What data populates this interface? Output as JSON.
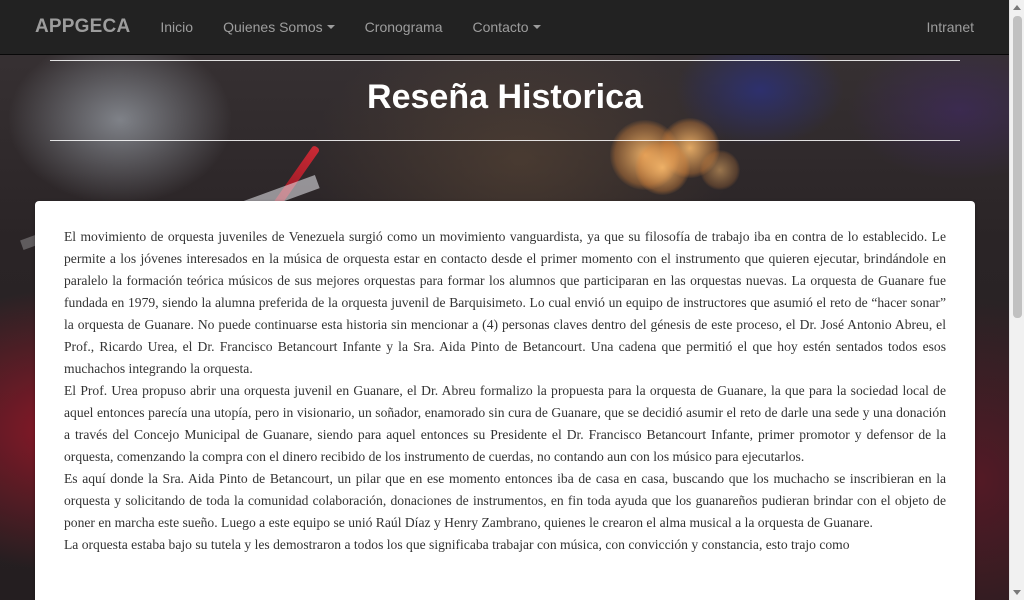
{
  "navbar": {
    "brand": "APPGECA",
    "items": [
      {
        "label": "Inicio",
        "dropdown": false
      },
      {
        "label": "Quienes Somos",
        "dropdown": true
      },
      {
        "label": "Cronograma",
        "dropdown": false
      },
      {
        "label": "Contacto",
        "dropdown": true
      }
    ],
    "right_item": "Intranet"
  },
  "header": {
    "title": "Reseña Historica"
  },
  "content": {
    "paragraphs": [
      "El movimiento de orquesta juveniles de Venezuela surgió como un movimiento vanguardista, ya que su filosofía de trabajo iba en contra de lo establecido. Le permite a los jóvenes interesados en la música de orquesta estar en contacto desde el primer momento con el instrumento que quieren ejecutar, brindándole en paralelo la formación teórica músicos de sus mejores orquestas para formar los alumnos que participaran en las orquestas nuevas. La orquesta de Guanare fue fundada en 1979, siendo la alumna preferida de la orquesta juvenil de Barquisimeto. Lo cual envió un equipo de instructores que asumió el reto de “hacer sonar” la orquesta de Guanare. No puede continuarse esta historia sin mencionar a (4) personas claves dentro del génesis de este proceso, el Dr. José Antonio Abreu, el Prof., Ricardo Urea, el Dr. Francisco Betancourt Infante y la Sra. Aida Pinto de Betancourt. Una cadena que permitió el que hoy estén sentados todos esos muchachos integrando la orquesta.",
      "El Prof. Urea propuso abrir una orquesta juvenil en Guanare, el Dr. Abreu formalizo la propuesta para la orquesta de Guanare, la que para la sociedad local de aquel entonces parecía una utopía, pero in visionario, un soñador, enamorado sin cura de Guanare, que se decidió asumir el reto de darle una sede y una donación a través del Concejo Municipal de Guanare, siendo para aquel entonces su Presidente el Dr. Francisco Betancourt Infante, primer promotor y defensor de la orquesta, comenzando la compra con el dinero recibido de los instrumento de cuerdas, no contando aun con los músico para ejecutarlos.",
      "Es aquí donde la Sra. Aida Pinto de Betancourt, un pilar que en ese momento entonces iba de casa en casa, buscando que los muchacho se inscribieran en la orquesta y solicitando de toda la comunidad colaboración, donaciones de instrumentos, en fin toda ayuda que los guanareños pudieran brindar con el objeto de poner en marcha este sueño. Luego a este equipo se unió Raúl Díaz y Henry Zambrano, quienes le crearon el alma musical a la orquesta de Guanare.",
      "La orquesta estaba bajo su tutela y les demostraron a todos los que significaba trabajar con música, con convicción y constancia, esto trajo como"
    ]
  }
}
